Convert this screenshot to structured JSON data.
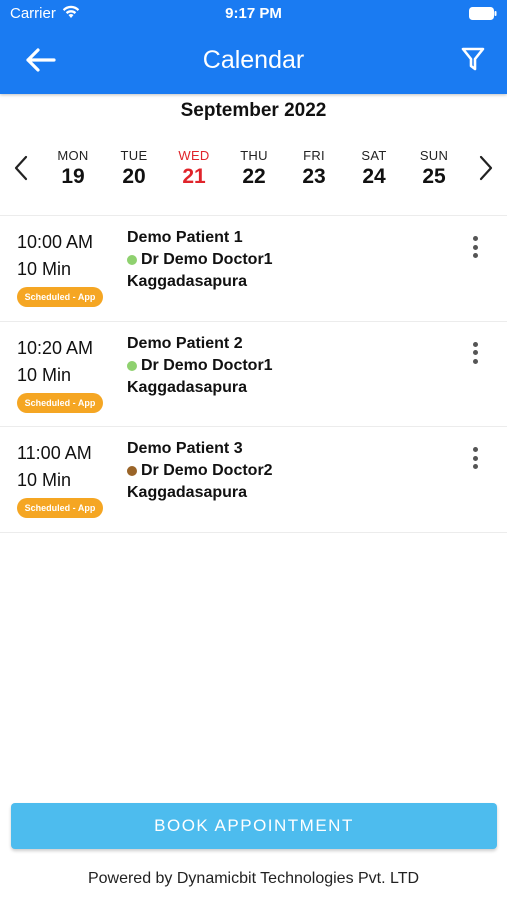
{
  "status_bar": {
    "carrier": "Carrier",
    "time": "9:17 PM"
  },
  "header": {
    "title": "Calendar",
    "back_icon": "arrow-left-icon",
    "filter_icon": "filter-icon"
  },
  "calendar": {
    "month_label": "September 2022",
    "days": [
      {
        "name": "MON",
        "number": "19"
      },
      {
        "name": "TUE",
        "number": "20"
      },
      {
        "name": "WED",
        "number": "21",
        "today": true
      },
      {
        "name": "THU",
        "number": "22"
      },
      {
        "name": "FRI",
        "number": "23"
      },
      {
        "name": "SAT",
        "number": "24"
      },
      {
        "name": "SUN",
        "number": "25"
      }
    ]
  },
  "appointments": [
    {
      "time": "10:00 AM",
      "duration": "10 Min",
      "status": "Scheduled - App",
      "patient": "Demo Patient 1",
      "doctor": "Dr Demo Doctor1",
      "doctor_color": "#8fd16f",
      "location": "Kaggadasapura"
    },
    {
      "time": "10:20 AM",
      "duration": "10 Min",
      "status": "Scheduled - App",
      "patient": "Demo Patient 2",
      "doctor": "Dr Demo Doctor1",
      "doctor_color": "#8fd16f",
      "location": "Kaggadasapura"
    },
    {
      "time": "11:00 AM",
      "duration": "10 Min",
      "status": "Scheduled - App",
      "patient": "Demo Patient 3",
      "doctor": "Dr Demo Doctor2",
      "doctor_color": "#9a6428",
      "location": "Kaggadasapura"
    }
  ],
  "actions": {
    "book_label": "BOOK APPOINTMENT"
  },
  "footer": {
    "text": "Powered by Dynamicbit Technologies Pvt. LTD"
  },
  "colors": {
    "header": "#1a7bf2",
    "today": "#e0242b",
    "badge": "#f5a623",
    "book_button": "#4dbcee"
  }
}
